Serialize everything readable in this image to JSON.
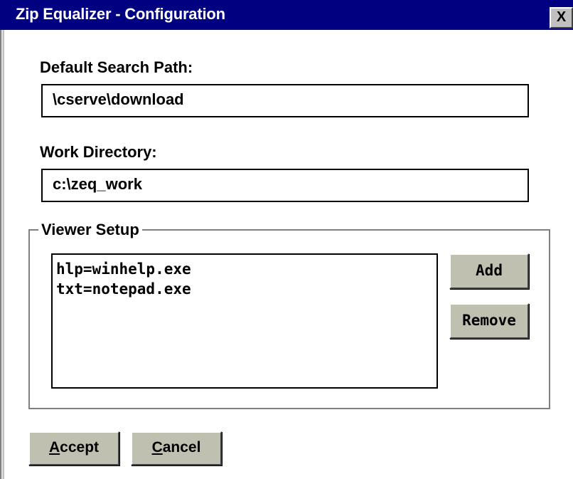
{
  "window": {
    "title": "Zip Equalizer - Configuration",
    "close_label": "X"
  },
  "default_search_path": {
    "label": "Default Search Path:",
    "value": "\\cserve\\download"
  },
  "work_directory": {
    "label": "Work Directory:",
    "value": "c:\\zeq_work"
  },
  "viewer_setup": {
    "group_label": "Viewer Setup",
    "items": [
      "hlp=winhelp.exe",
      "txt=notepad.exe"
    ],
    "add_label": "Add",
    "remove_label": "Remove"
  },
  "buttons": {
    "accept_mnemonic": "A",
    "accept_rest": "ccept",
    "cancel_mnemonic": "C",
    "cancel_rest": "ancel"
  },
  "colors": {
    "title_bar": "#000080",
    "button_face": "#c0c0b0"
  }
}
